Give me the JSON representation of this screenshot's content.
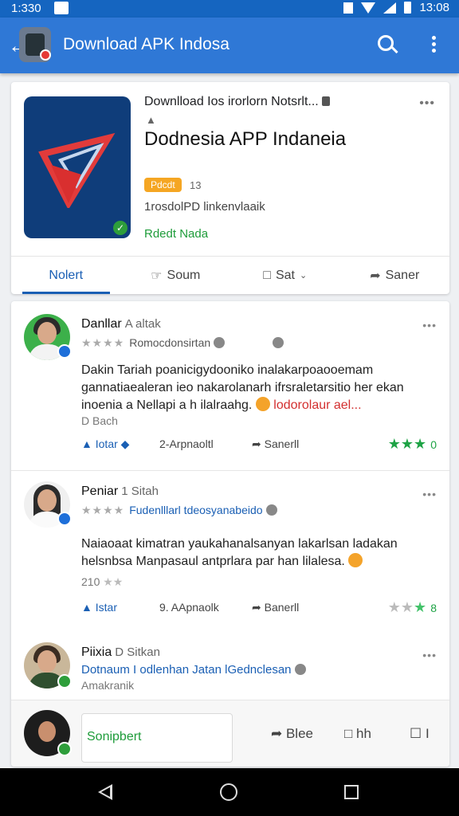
{
  "status_bar": {
    "time_left": "1:330",
    "time_right": "13:08"
  },
  "app_bar": {
    "title": "Download APK Indosa"
  },
  "app_info": {
    "developer_line": "Downlload Ios irorlorn  Notsrlt...",
    "name": "Dodnesia APP Indaneia",
    "tag": "Pdcdt",
    "tag_count": "13",
    "meta": "1rosdolPD linkenvlaaik",
    "green_text": "Rdedt Nada",
    "tabs": [
      {
        "label": "Nolert",
        "icon": ""
      },
      {
        "label": "Soum",
        "icon": "share-hand-icon"
      },
      {
        "label": "Sat",
        "icon": "bookmark-icon"
      },
      {
        "label": "Saner",
        "icon": "share-arrow-icon"
      }
    ]
  },
  "reviews": [
    {
      "name": "Danllar",
      "name_extra": "A altak",
      "sub": "Romocdonsirtan",
      "body_line1": "Dakin Tariah poanicigydooniko inalakarpoaooemam",
      "body_line2": "gannatiaealeran ieo nakarolanarh ifrsraletarsitio her ekan",
      "body_line3_a": "inoenia a Nellapi a h ilalraahg.",
      "body_line3_red": "lodorolaur ael...",
      "date": "D Bach",
      "action_a": "Iotar",
      "action_b": "2-Arpnaoltl",
      "action_c": "Sanerll",
      "rating_text": "0"
    },
    {
      "name": "Peniar",
      "name_extra": "1 Sitah",
      "sub": "Fudenlllarl tdeosyanabeido",
      "body_line1": "Naiaoaat kimatran yaukahanalsanyan lakarlsan ladakan",
      "body_line2": "helsnbsa Manpasaul antprlara par han lilalesa.",
      "date": "210",
      "action_a": "Istar",
      "action_b": "9. AApnaolk",
      "action_c": "Banerll",
      "rating_text": "8"
    },
    {
      "name": "Piixia",
      "name_extra": "D Sitkan",
      "sub": "Dotnaum I odlenhan Jatan lGednclesan",
      "date": "Amakranik"
    }
  ],
  "composer": {
    "placeholder": "Sonipbert",
    "btn_a": "Blee",
    "btn_b": "hh",
    "btn_c": "I"
  },
  "colors": {
    "app_bar": "#2f78d6",
    "status_bar": "#1565c0",
    "accent_green": "#1e9c3a",
    "link_blue": "#1a5fb4"
  }
}
